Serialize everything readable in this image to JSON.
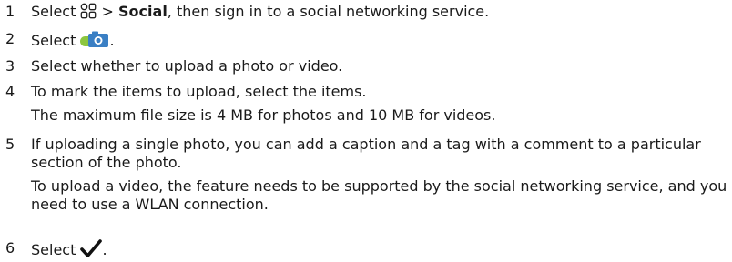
{
  "steps": [
    {
      "number": "1",
      "pre": "Select ",
      "icon": "menu-grid-icon",
      "gt": " > ",
      "bold": "Social",
      "post": ", then sign in to a social networking service."
    },
    {
      "number": "2",
      "pre": "Select ",
      "icon": "upload-camera-icon",
      "post": "."
    },
    {
      "number": "3",
      "text": "Select whether to upload a photo or video."
    },
    {
      "number": "4",
      "text": "To mark the items to upload, select the items.",
      "note": "The maximum file size is 4 MB for photos and 10 MB for videos."
    },
    {
      "number": "5",
      "text": "If uploading a single photo, you can add a caption and a tag with a comment to a particular section of the photo.",
      "note": "To upload a video, the feature needs to be supported by the social networking service, and you need to use a WLAN connection."
    },
    {
      "number": "6",
      "pre": "Select ",
      "icon": "checkmark-icon",
      "post": "."
    }
  ],
  "colors": {
    "text": "#1a1a1a",
    "camera_green": "#8cc63f",
    "camera_blue": "#3a7fc4",
    "checkmark": "#111111"
  }
}
